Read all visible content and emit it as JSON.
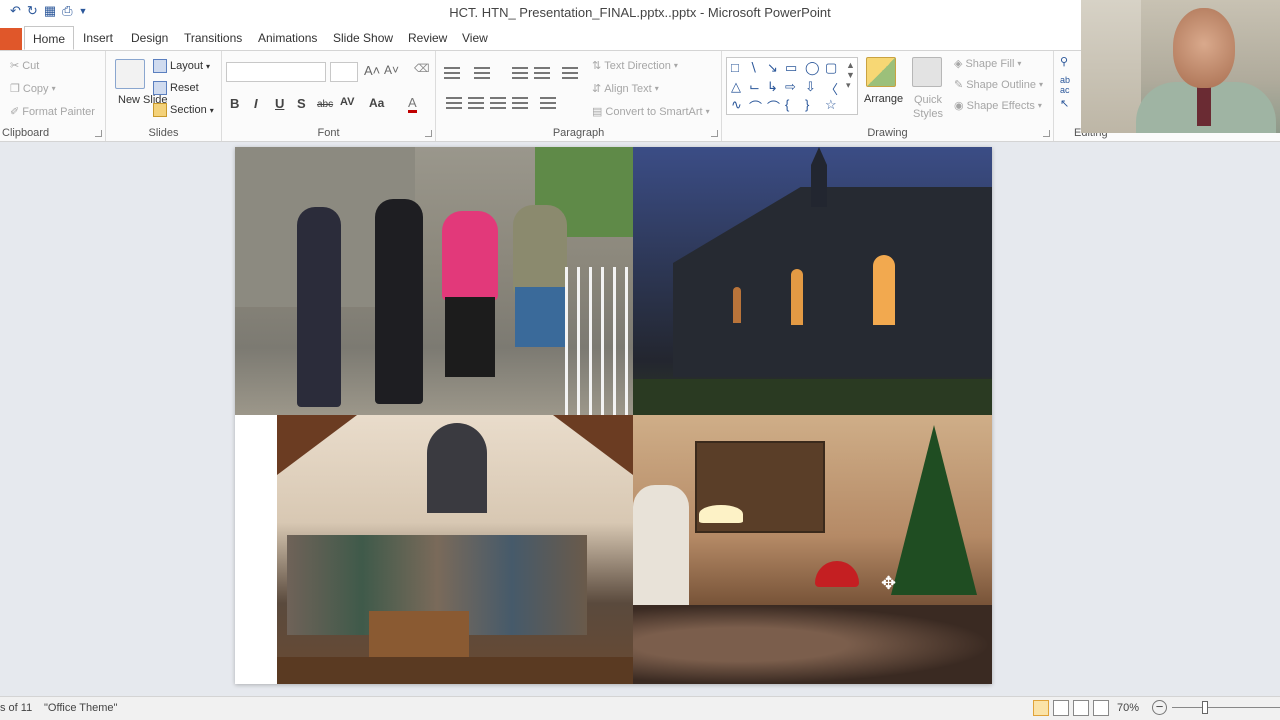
{
  "window": {
    "title": "HCT. HTN_ Presentation_FINAL.pptx..pptx - Microsoft PowerPoint"
  },
  "qat": {
    "icons": [
      "undo-icon",
      "redo-icon",
      "print-preview-icon",
      "print-icon",
      "customize-icon"
    ]
  },
  "tabs": [
    {
      "label": "Home",
      "active": true
    },
    {
      "label": "Insert"
    },
    {
      "label": "Design"
    },
    {
      "label": "Transitions"
    },
    {
      "label": "Animations"
    },
    {
      "label": "Slide Show"
    },
    {
      "label": "Review"
    },
    {
      "label": "View"
    }
  ],
  "ribbon": {
    "clipboard": {
      "cut": "Cut",
      "copy": "Copy",
      "format_painter": "Format Painter",
      "label": "Clipboard"
    },
    "slides": {
      "new_slide": "New Slide",
      "layout": "Layout",
      "reset": "Reset",
      "section": "Section",
      "label": "Slides"
    },
    "font": {
      "bold": "B",
      "italic": "I",
      "underline": "U",
      "shadow": "S",
      "strike": "abc",
      "spacing": "AV",
      "case": "Aa",
      "color": "A",
      "label": "Font"
    },
    "paragraph": {
      "text_direction": "Text Direction",
      "align_text": "Align Text",
      "smartart": "Convert to SmartArt",
      "label": "Paragraph"
    },
    "drawing": {
      "arrange": "Arrange",
      "quick_styles": "Quick Styles",
      "shape_fill": "Shape Fill",
      "shape_outline": "Shape Outline",
      "shape_effects": "Shape Effects",
      "label": "Drawing"
    },
    "editing": {
      "label": "Editing"
    }
  },
  "status": {
    "slide": "s of 11",
    "theme": "\"Office Theme\"",
    "zoom": "70%"
  },
  "colors": {
    "file_tab": "#e0572a",
    "accent": "#2b579a",
    "active_view": "#fbe3a8"
  }
}
